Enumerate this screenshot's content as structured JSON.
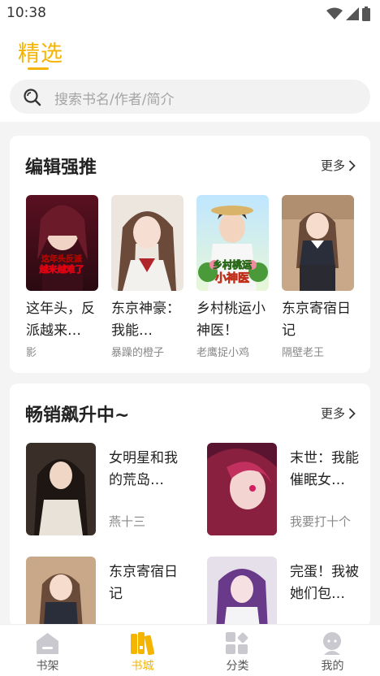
{
  "status_bar": {
    "time": "10:38"
  },
  "header": {
    "title": "精选"
  },
  "search": {
    "placeholder": "搜索书名/作者/简介"
  },
  "editor_picks": {
    "title": "编辑强推",
    "more_label": "更多",
    "books": [
      {
        "name": "这年头，反派越来…",
        "author": "影",
        "cover_text_1": "这年头反派",
        "cover_text_2": "越来越难了"
      },
      {
        "name": "东京神豪：我能…",
        "author": "暴躁的橙子"
      },
      {
        "name": "乡村桃运小神医！",
        "author": "老鹰捉小鸡",
        "cover_text_1": "乡村桃运",
        "cover_text_2": "小神医"
      },
      {
        "name": "东京寄宿日记",
        "author": "隔壁老王"
      }
    ]
  },
  "best_sellers": {
    "title": "畅销飙升中~",
    "more_label": "更多",
    "books": [
      {
        "name": "女明星和我的荒岛…",
        "author": "燕十三"
      },
      {
        "name": "末世：我能催眠女…",
        "author": "我要打十个"
      },
      {
        "name": "东京寄宿日记",
        "author": ""
      },
      {
        "name": "完蛋！我被她们包…",
        "author": ""
      }
    ]
  },
  "tabbar": {
    "items": [
      {
        "label": "书架",
        "icon": "bookshelf-icon"
      },
      {
        "label": "书城",
        "icon": "bookstore-icon"
      },
      {
        "label": "分类",
        "icon": "category-icon"
      },
      {
        "label": "我的",
        "icon": "profile-icon"
      }
    ],
    "active_index": 1
  },
  "colors": {
    "accent": "#f5b400",
    "text": "#222222",
    "muted": "#888888",
    "background": "#f4f4f4"
  }
}
